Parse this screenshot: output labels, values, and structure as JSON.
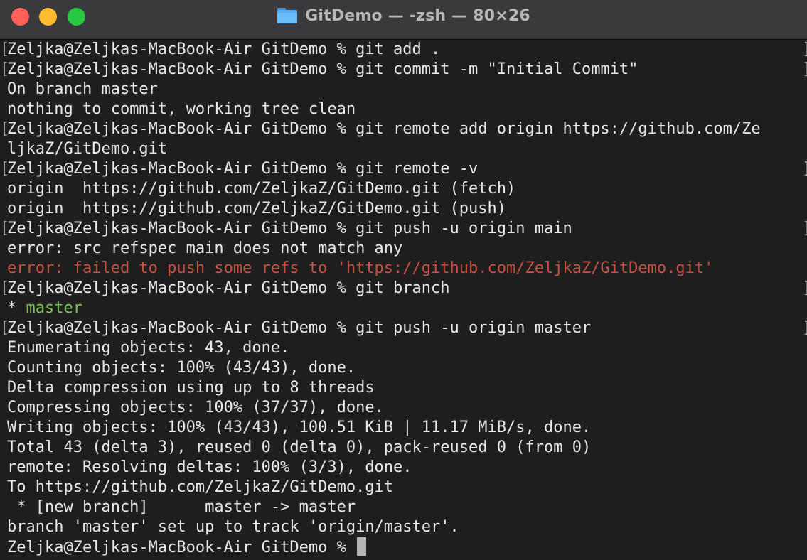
{
  "window": {
    "title": "GitDemo — -zsh — 80×26"
  },
  "colors": {
    "background": "#1e1e1e",
    "text": "#e8e8e8",
    "error": "#c65142",
    "branch": "#7cc24e"
  },
  "terminal": {
    "lines": [
      "Zeljka@Zeljkas-MacBook-Air GitDemo % git add .",
      "Zeljka@Zeljkas-MacBook-Air GitDemo % git commit -m \"Initial Commit\"",
      "On branch master",
      "nothing to commit, working tree clean",
      "Zeljka@Zeljkas-MacBook-Air GitDemo % git remote add origin https://github.com/Ze",
      "ljkaZ/GitDemo.git",
      "Zeljka@Zeljkas-MacBook-Air GitDemo % git remote -v",
      "origin  https://github.com/ZeljkaZ/GitDemo.git (fetch)",
      "origin  https://github.com/ZeljkaZ/GitDemo.git (push)",
      "Zeljka@Zeljkas-MacBook-Air GitDemo % git push -u origin main",
      "error: src refspec main does not match any",
      "error: failed to push some refs to 'https://github.com/ZeljkaZ/GitDemo.git'",
      "Zeljka@Zeljkas-MacBook-Air GitDemo % git branch",
      "* ",
      "Zeljka@Zeljkas-MacBook-Air GitDemo % git push -u origin master",
      "Enumerating objects: 43, done.",
      "Counting objects: 100% (43/43), done.",
      "Delta compression using up to 8 threads",
      "Compressing objects: 100% (37/37), done.",
      "Writing objects: 100% (43/43), 100.51 KiB | 11.17 MiB/s, done.",
      "Total 43 (delta 3), reused 0 (delta 0), pack-reused 0 (from 0)",
      "remote: Resolving deltas: 100% (3/3), done.",
      "To https://github.com/ZeljkaZ/GitDemo.git",
      " * [new branch]      master -> master",
      "branch 'master' set up to track 'origin/master'.",
      "Zeljka@Zeljkas-MacBook-Air GitDemo % "
    ],
    "current_branch": "master",
    "bracket_left": "[",
    "bracket_right": "]"
  }
}
